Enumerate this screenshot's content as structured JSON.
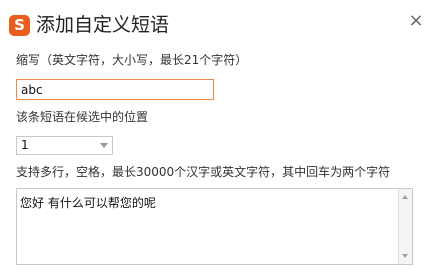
{
  "dialog": {
    "logo_letter": "S",
    "title": "添加自定义短语",
    "close_glyph": "×"
  },
  "abbreviation": {
    "label": "缩写（英文字符，大小写，最长21个字符）",
    "value": "abc"
  },
  "position": {
    "label": "该条短语在候选中的位置",
    "selected": "1"
  },
  "phrase": {
    "label": "支持多行，空格，最长30000个汉字或英文字符，其中回车为两个字符",
    "value": "您好 有什么可以帮您的呢"
  },
  "colors": {
    "logo": "#ea5d1e",
    "input_focus_border": "#f08a4b"
  }
}
